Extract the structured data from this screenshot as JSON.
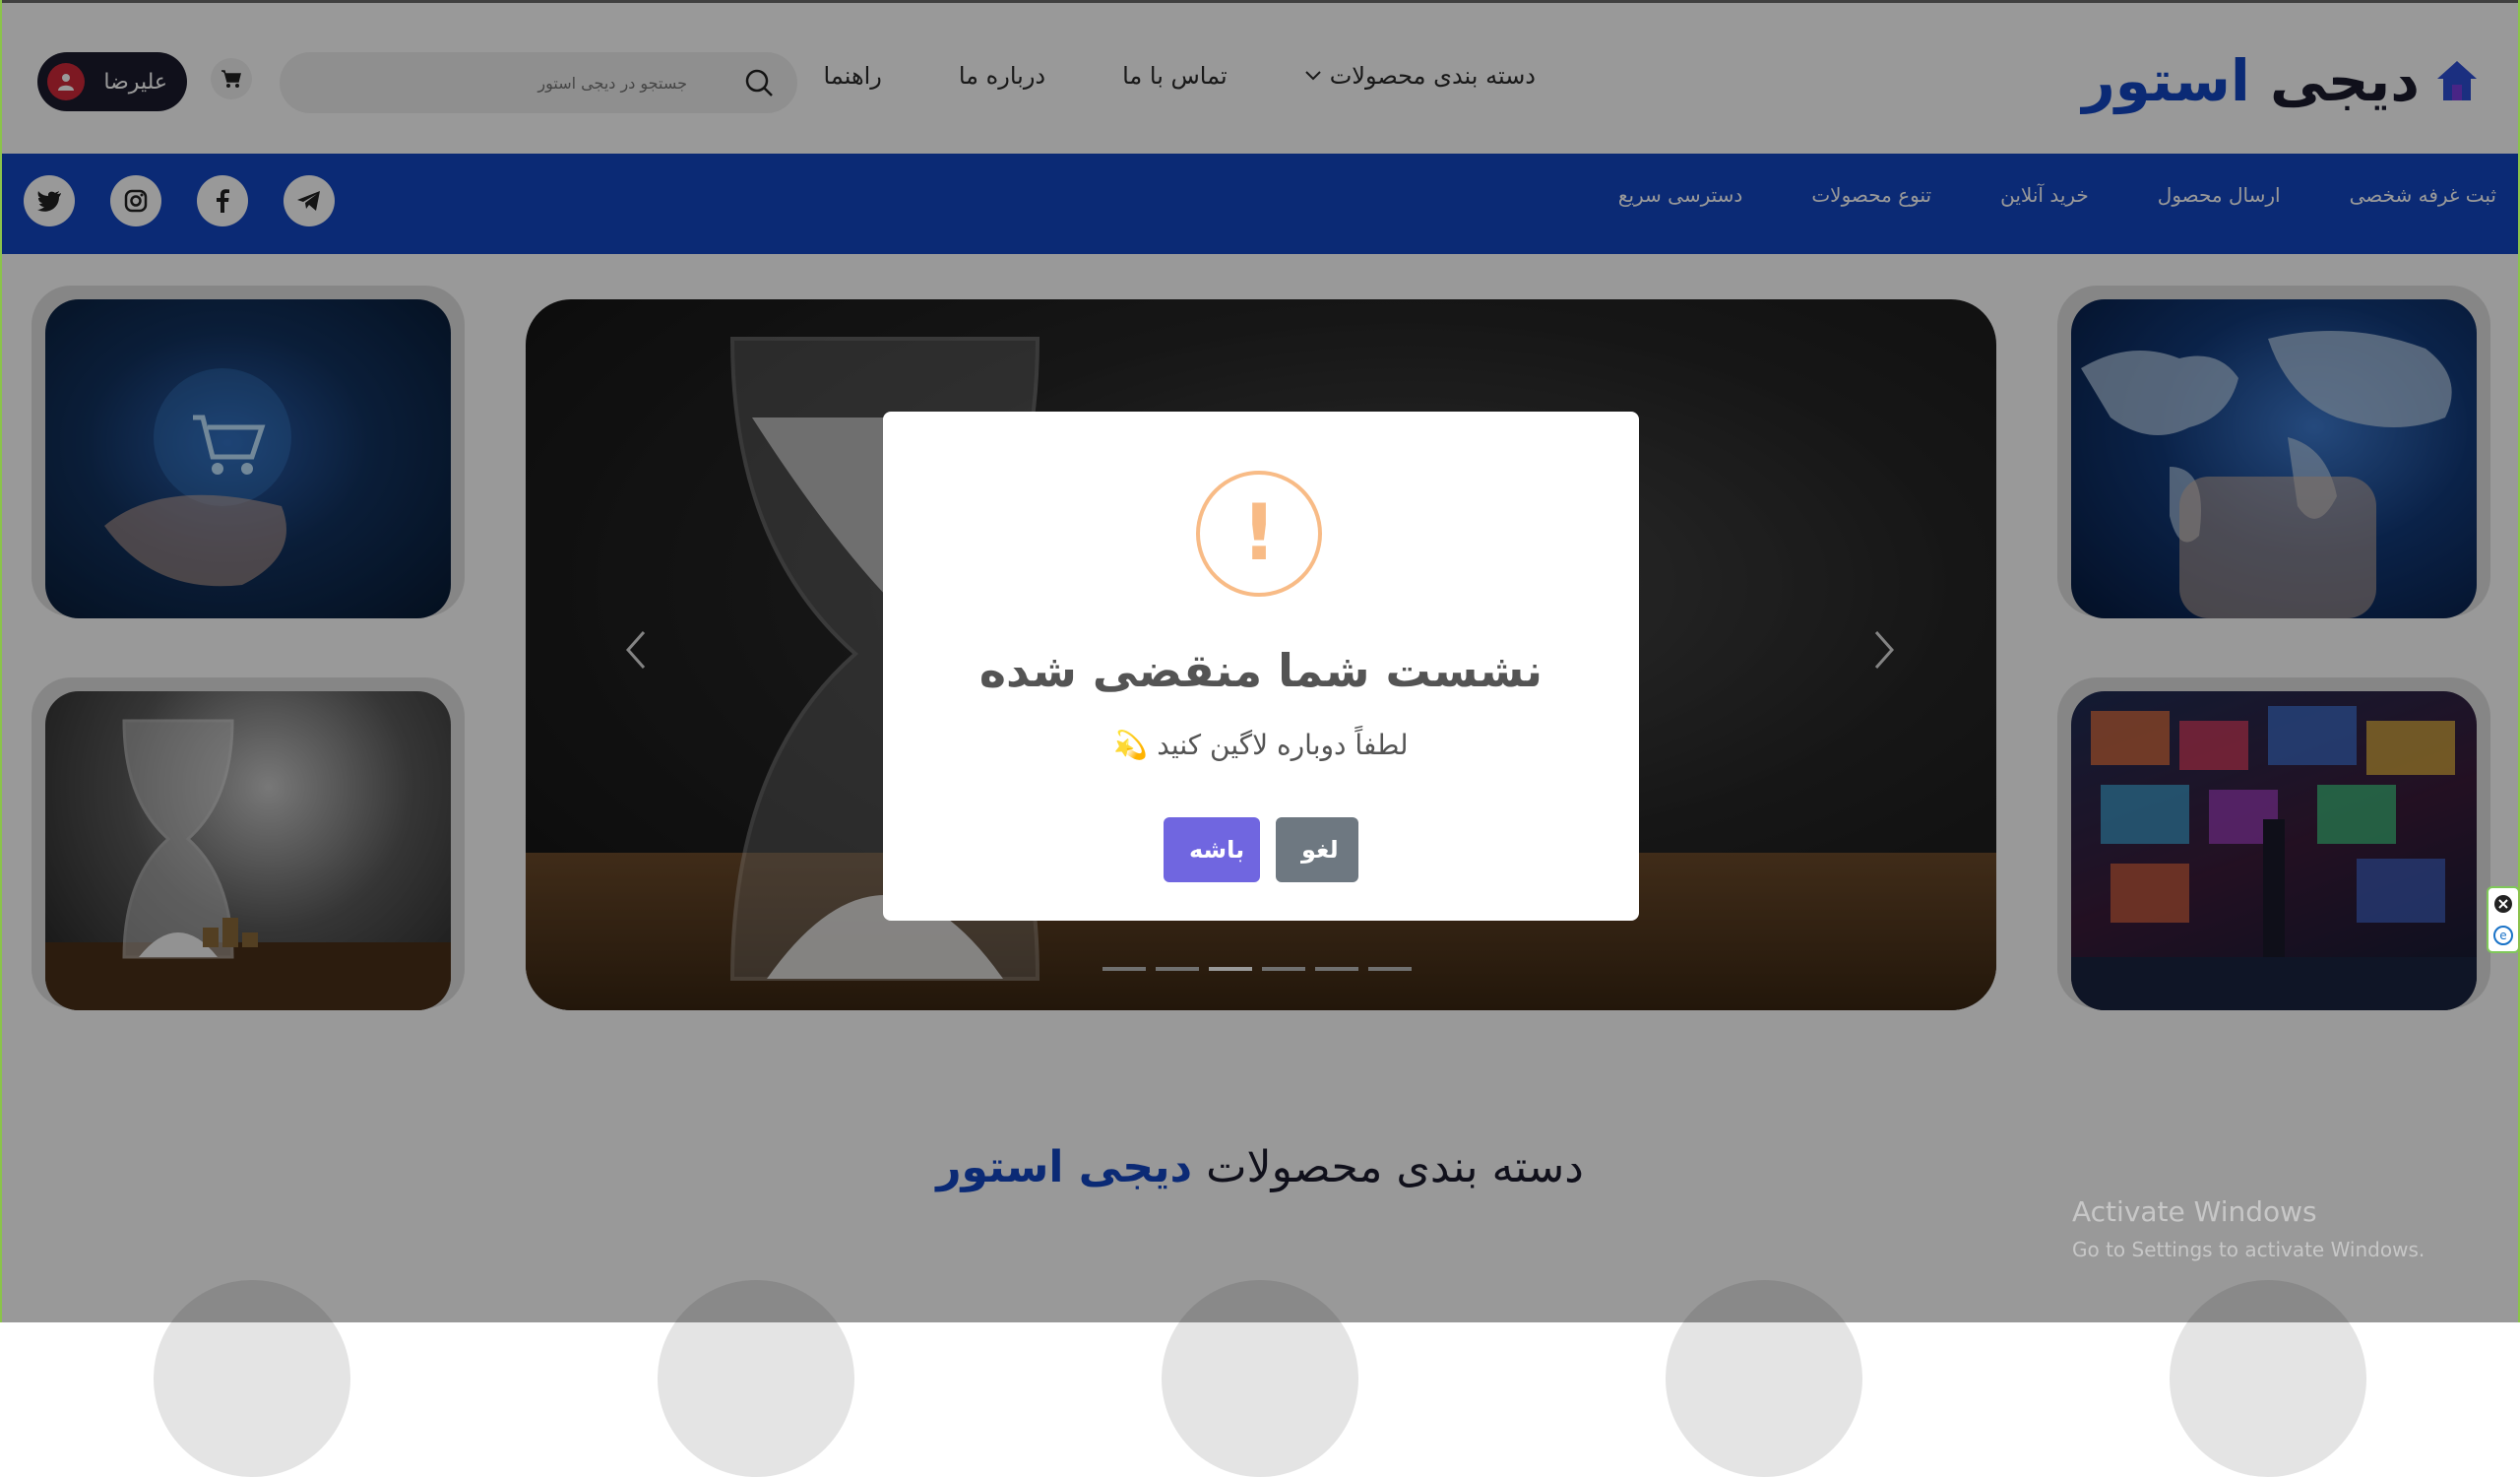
{
  "header": {
    "logo_main": "دیجی ",
    "logo_accent": "استور",
    "logo_icon": "home-icon",
    "nav": [
      {
        "label": "دسته بندی محصولات",
        "has_dropdown": true
      },
      {
        "label": "تماس با ما"
      },
      {
        "label": "درباره ما"
      },
      {
        "label": "راهنما"
      }
    ],
    "search_placeholder": "جستجو در دیجی استور",
    "user_name": "علیرضا"
  },
  "bluebar": {
    "links": [
      "ثبت غرفه شخصی",
      "ارسال محصول",
      "خرید آنلاین",
      "تنوع محصولات",
      "دسترسی سریع"
    ],
    "socials": [
      "telegram-icon",
      "facebook-icon",
      "instagram-icon",
      "twitter-icon"
    ]
  },
  "carousel": {
    "slide_count": 6,
    "active_index": 2
  },
  "section": {
    "title_main": "دسته بندی محصولات ",
    "title_accent": "دیجی استور"
  },
  "modal": {
    "icon": "warning-icon",
    "icon_glyph": "!",
    "title": "نشست شما منقضی شده",
    "text": "لطفاً دوباره لاگین کنید",
    "emoji": "💫",
    "ok_label": "باشه",
    "cancel_label": "لغو"
  },
  "watermark": {
    "line1": "Activate Windows",
    "line2": "Go to Settings to activate Windows."
  },
  "colors": {
    "brand": "#1346c4",
    "dark": "#1c1c2e",
    "ok": "#7066e0",
    "cancel": "#6e7881",
    "warning": "#f8bb86"
  }
}
